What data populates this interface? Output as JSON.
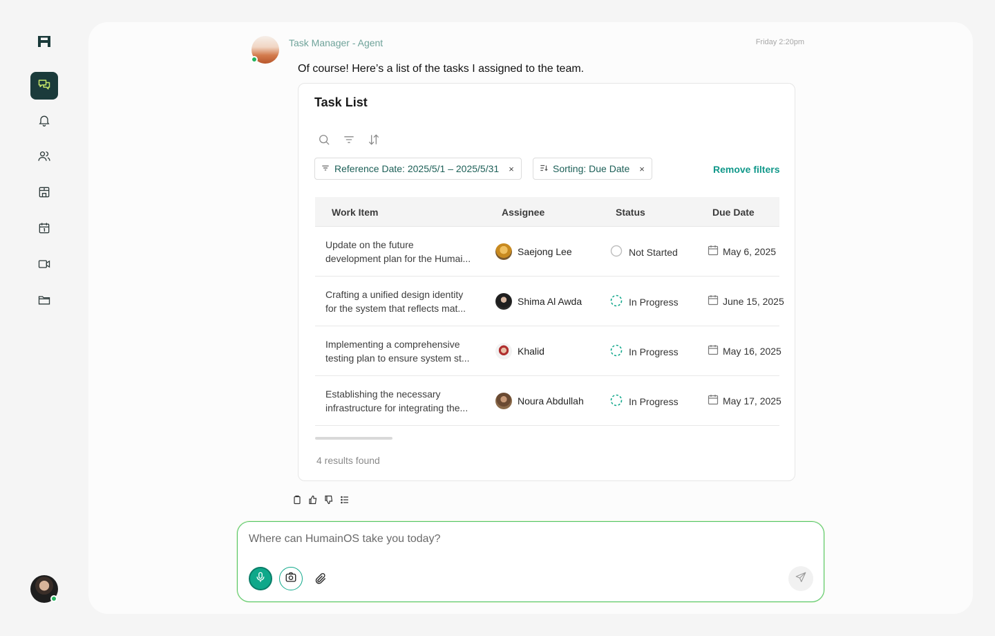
{
  "sidebar": {
    "nav": [
      {
        "name": "chat-icon",
        "active": true
      },
      {
        "name": "bell-icon",
        "active": false
      },
      {
        "name": "users-icon",
        "active": false
      },
      {
        "name": "store-icon",
        "active": false
      },
      {
        "name": "calendar-icon",
        "active": false
      },
      {
        "name": "video-icon",
        "active": false
      },
      {
        "name": "folder-icon",
        "active": false
      }
    ]
  },
  "message": {
    "agent_name": "Task Manager - Agent",
    "time": "Friday 2:20pm",
    "text": "Of course! Here’s a list of the tasks I assigned to the team."
  },
  "task_card": {
    "title": "Task List",
    "filters": [
      {
        "label": "Reference Date: 2025/5/1 – 2025/5/31",
        "remove": "×"
      },
      {
        "label": "Sorting: Due Date",
        "remove": "×"
      }
    ],
    "remove_filters": "Remove filters",
    "columns": [
      "Work Item",
      "Assignee",
      "Status",
      "Due Date"
    ],
    "rows": [
      {
        "line1": "Update on the future",
        "line2": "development plan for the Humai...",
        "assignee": "Saejong Lee",
        "status": "Not Started",
        "due": "May 6, 2025"
      },
      {
        "line1": "Crafting a unified design identity",
        "line2": "for the system that reflects mat...",
        "assignee": "Shima Al Awda",
        "status": "In Progress",
        "due": "June 15, 2025"
      },
      {
        "line1": "Implementing a comprehensive",
        "line2": "testing plan to ensure system st...",
        "assignee": "Khalid",
        "status": "In Progress",
        "due": "May 16, 2025"
      },
      {
        "line1": "Establishing the necessary",
        "line2": "infrastructure for integrating the...",
        "assignee": "Noura Abdullah",
        "status": "In Progress",
        "due": "May 17, 2025"
      }
    ],
    "results": "4 results found"
  },
  "composer": {
    "placeholder": "Where can HumainOS take you today?"
  },
  "colors": {
    "accent": "#0fa88a",
    "active_nav_bg": "#1b3b3b",
    "online": "#22b35e"
  }
}
